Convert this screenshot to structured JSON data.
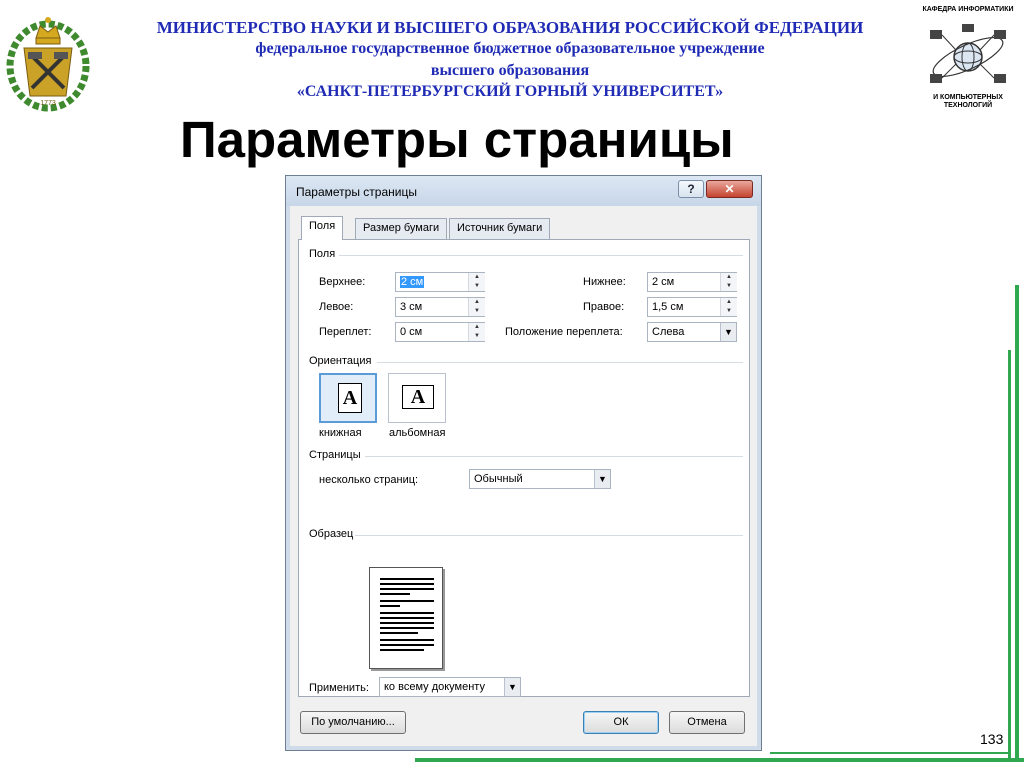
{
  "header": {
    "line1": "МИНИСТЕРСТВО НАУКИ И ВЫСШЕГО ОБРАЗОВАНИЯ РОССИЙСКОЙ ФЕДЕРАЦИИ",
    "line2": "федеральное государственное бюджетное образовательное учреждение",
    "line3": "высшего образования",
    "line4": "«САНКТ-ПЕТЕРБУРГСКИЙ ГОРНЫЙ УНИВЕРСИТЕТ»",
    "dept_top": "КАФЕДРА ИНФОРМАТИКИ",
    "dept_bottom": "И КОМПЬЮТЕРНЫХ ТЕХНОЛОГИЙ",
    "emblem_year": "1773"
  },
  "slide": {
    "title": "Параметры страницы",
    "number": "133"
  },
  "dialog": {
    "title": "Параметры страницы",
    "help": "?",
    "close": "✕",
    "tabs": [
      "Поля",
      "Размер бумаги",
      "Источник бумаги"
    ],
    "margins_group": "Поля",
    "top_label": "Верхнее:",
    "top_value": "2 см",
    "bottom_label": "Нижнее:",
    "bottom_value": "2 см",
    "left_label": "Левое:",
    "left_value": "3 см",
    "right_label": "Правое:",
    "right_value": "1,5 см",
    "gutter_label": "Переплет:",
    "gutter_value": "0 см",
    "gutter_pos_label": "Положение переплета:",
    "gutter_pos_value": "Слева",
    "orientation_group": "Ориентация",
    "portrait_label": "книжная",
    "landscape_label": "альбомная",
    "pages_group": "Страницы",
    "multiple_pages_label": "несколько страниц:",
    "multiple_pages_value": "Обычный",
    "preview_group": "Образец",
    "apply_label": "Применить:",
    "apply_value": "ко всему документу",
    "default_button": "По умолчанию...",
    "ok_button": "ОК",
    "cancel_button": "Отмена"
  },
  "icons": {
    "page_glyph": "A",
    "spin_up": "▲",
    "spin_down": "▼",
    "dropdown": "▼"
  },
  "colors": {
    "header_blue": "#1f2bb5",
    "frame_green": "#2fa84f",
    "selection_blue": "#3399ff"
  }
}
